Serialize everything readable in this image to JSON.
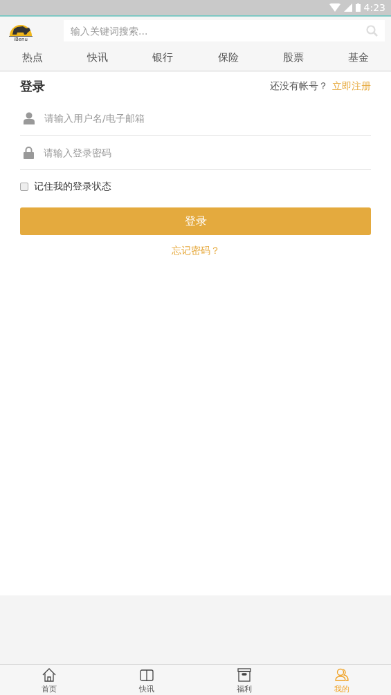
{
  "status_bar": {
    "time": "4:23"
  },
  "header": {
    "logo_text": "iBenu",
    "search": {
      "placeholder": "输入关键词搜索..."
    }
  },
  "categories": [
    {
      "label": "热点"
    },
    {
      "label": "快讯"
    },
    {
      "label": "银行"
    },
    {
      "label": "保险"
    },
    {
      "label": "股票"
    },
    {
      "label": "基金"
    }
  ],
  "login": {
    "title": "登录",
    "no_account": "还没有帐号？",
    "register_link": "立即注册",
    "fields": [
      {
        "kind": "user",
        "placeholder": "请输入用户名/电子邮箱"
      },
      {
        "kind": "password",
        "placeholder": "请输入登录密码"
      }
    ],
    "remember": {
      "label": "记住我的登录状态",
      "checked": false
    },
    "submit": "登录",
    "forgot": "忘记密码？"
  },
  "bottom_tabs": [
    {
      "kind": "home",
      "label": "首页",
      "selected": false
    },
    {
      "kind": "book",
      "label": "快讯",
      "selected": false
    },
    {
      "kind": "box",
      "label": "福利",
      "selected": false
    },
    {
      "kind": "people",
      "label": "我的",
      "selected": true
    }
  ]
}
